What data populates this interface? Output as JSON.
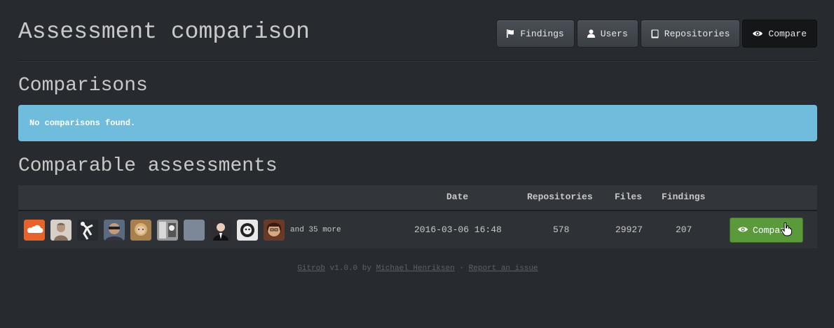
{
  "header": {
    "title": "Assessment comparison",
    "nav": [
      {
        "label": "Findings",
        "icon": "flag-icon",
        "active": false
      },
      {
        "label": "Users",
        "icon": "user-icon",
        "active": false
      },
      {
        "label": "Repositories",
        "icon": "book-icon",
        "active": false
      },
      {
        "label": "Compare",
        "icon": "eye-icon",
        "active": true
      }
    ]
  },
  "comparisons": {
    "title": "Comparisons",
    "alert": "No comparisons found."
  },
  "comparable": {
    "title": "Comparable assessments",
    "columns": [
      "Date",
      "Repositories",
      "Files",
      "Findings"
    ],
    "rows": [
      {
        "more_text": "and 35 more",
        "date": "2016-03-06 16:48",
        "repositories": "578",
        "files": "29927",
        "findings": "207",
        "action": "Compare",
        "avatar_colors": [
          "#e8632b",
          "#b9a597",
          "#ffffff",
          "#6c7a8c",
          "#c89448",
          "#8a8a8a",
          "#7c8797",
          "#2f2f33",
          "#d8d8d8",
          "#6a3a28"
        ]
      }
    ]
  },
  "footer": {
    "app": "Gitrob",
    "version": "v1.0.0 by",
    "author": "Michael Henriksen",
    "separator": "·",
    "report": "Report an issue"
  },
  "colors": {
    "background": "#272b30",
    "alert": "#6fbcdc",
    "compare_button": "#5a9a3a"
  }
}
